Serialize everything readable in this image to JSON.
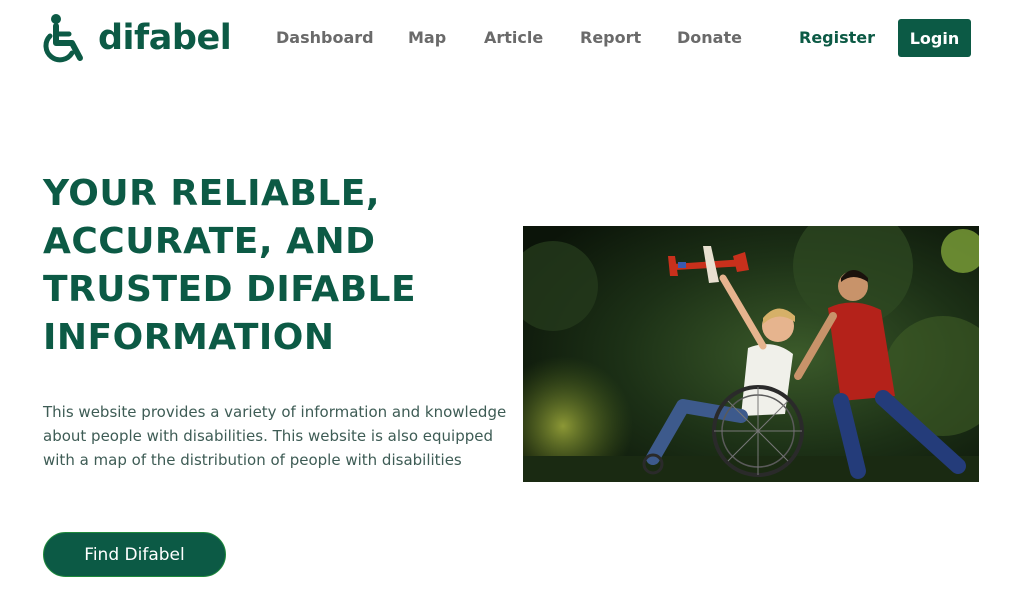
{
  "brand": {
    "name": "difabel",
    "color": "#0c5a45"
  },
  "nav": {
    "items": [
      {
        "label": "Dashboard"
      },
      {
        "label": "Map"
      },
      {
        "label": "Article"
      },
      {
        "label": "Report"
      },
      {
        "label": "Donate"
      }
    ],
    "register_label": "Register",
    "login_label": "Login"
  },
  "hero": {
    "title": "YOUR RELIABLE, ACCURATE, AND TRUSTED DIFABLE INFORMATION",
    "description": "This website provides a variety of information and knowledge about people with disabilities. This website is also equipped with a map of the distribution of people with disabilities",
    "cta_label": "Find Difabel",
    "image_icon": "hero-photo-child-in-wheelchair"
  },
  "icons": {
    "logo": "wheelchair-icon"
  }
}
